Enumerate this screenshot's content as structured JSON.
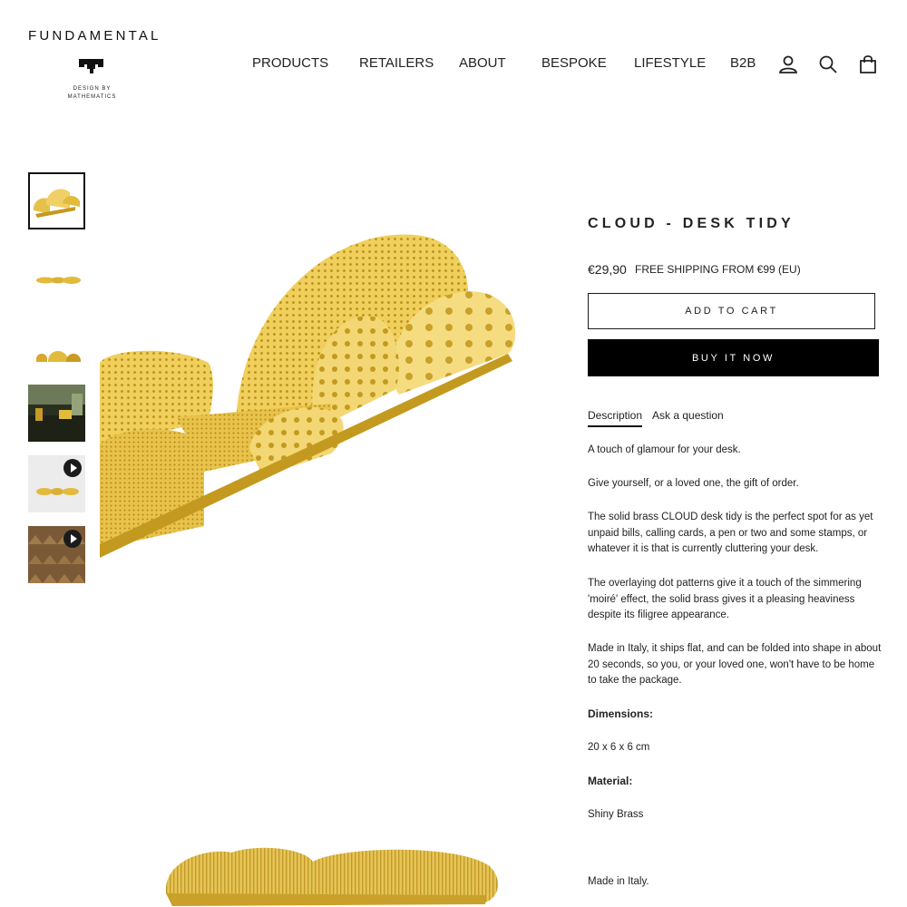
{
  "header": {
    "brand": "FUNDAMENTAL",
    "tagline": [
      "DESIGN BY",
      "MATHEMATICS"
    ],
    "nav": [
      "PRODUCTS",
      "RETAILERS",
      "ABOUT",
      "BESPOKE",
      "LIFESTYLE",
      "B2B"
    ],
    "icons": [
      "account-icon",
      "search-icon",
      "cart-icon"
    ]
  },
  "gallery": {
    "thumbnails": [
      {
        "name": "product-angle",
        "active": true,
        "video": false
      },
      {
        "name": "product-flat",
        "active": false,
        "video": false
      },
      {
        "name": "product-side",
        "active": false,
        "video": false
      },
      {
        "name": "lifestyle-desk",
        "active": false,
        "video": false
      },
      {
        "name": "product-video",
        "active": false,
        "video": true
      },
      {
        "name": "pattern-video",
        "active": false,
        "video": true
      }
    ]
  },
  "product": {
    "title": "CLOUD - DESK TIDY",
    "price": "€29,90",
    "shipping": "FREE SHIPPING FROM €99 (EU)",
    "add_to_cart": "ADD TO CART",
    "buy_now": "BUY IT NOW",
    "tabs": [
      "Description",
      "Ask a question"
    ],
    "description": [
      "A touch of glamour for your desk.",
      "Give yourself, or a loved one, the gift of order.",
      "The solid brass CLOUD desk tidy is the perfect spot for as yet unpaid bills, calling cards, a pen or two and some stamps, or whatever it is that is currently cluttering your desk.",
      "The overlaying dot patterns give it a touch of the simmering 'moiré' effect, the solid brass gives it a pleasing heaviness despite its filigree appearance.",
      "Made in Italy, it ships flat, and can be folded into shape in about 20 seconds, so you, or your loved one, won't have to be home to take the package."
    ],
    "dimensions_label": "Dimensions:",
    "dimensions": "20 x 6 x 6 cm",
    "material_label": "Material:",
    "material": "Shiny Brass",
    "origin": "Made in Italy."
  },
  "colors": {
    "brass_light": "#f3d774",
    "brass": "#e2bb3c",
    "brass_dark": "#c39a1f"
  }
}
